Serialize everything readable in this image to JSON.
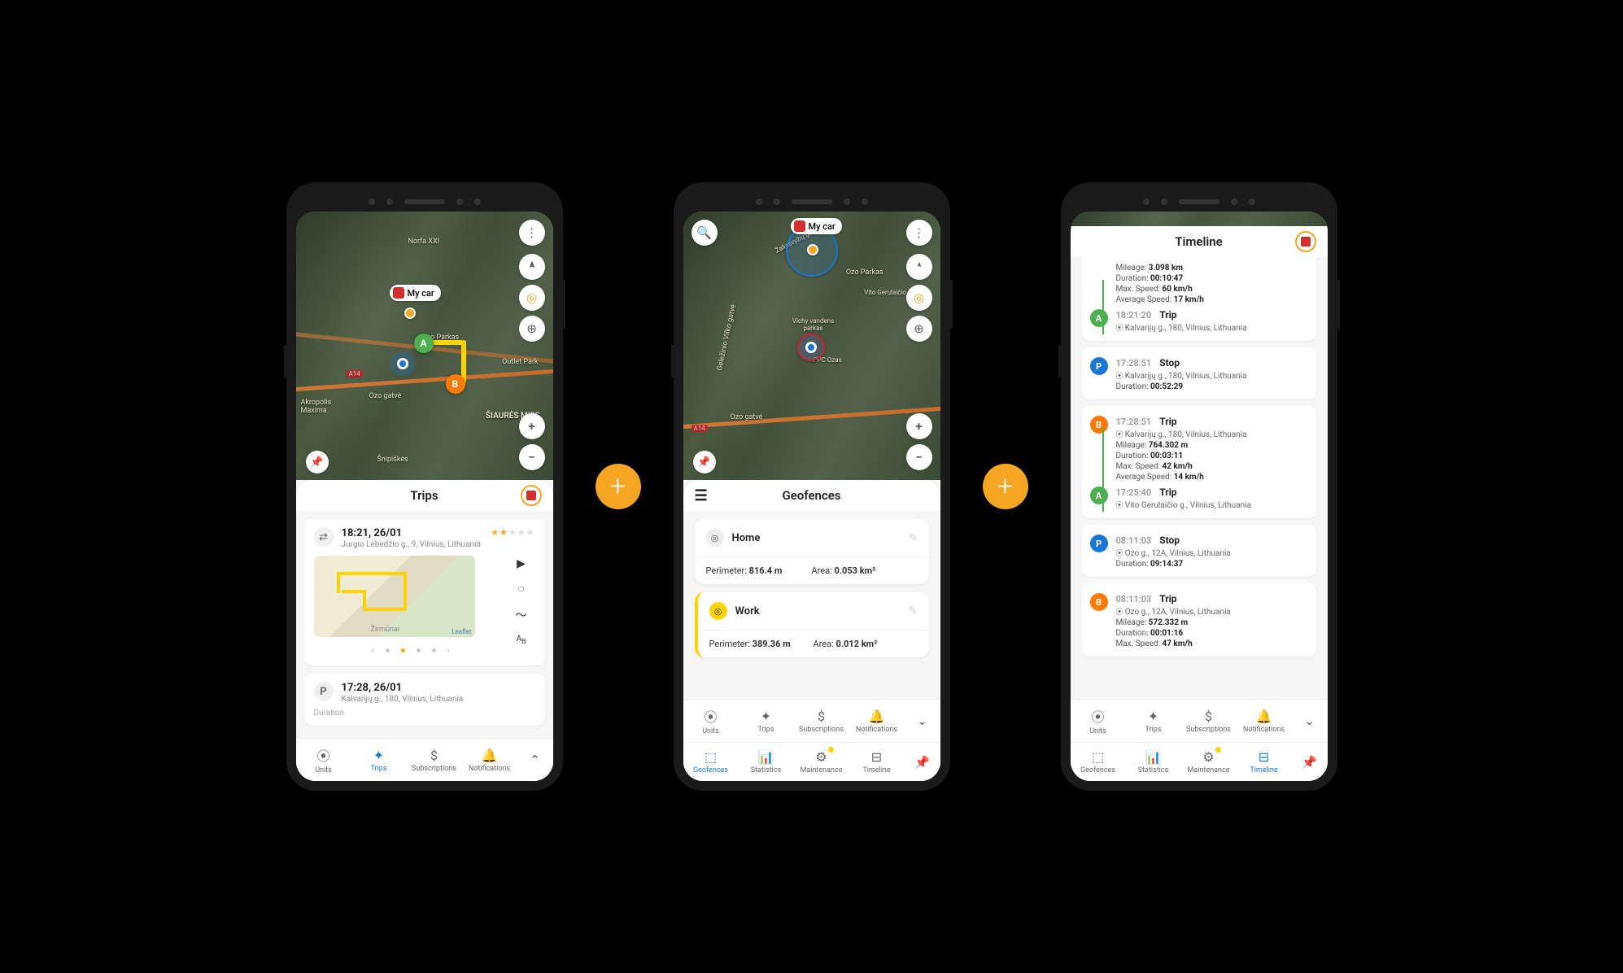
{
  "unit_label": "My car",
  "phone1": {
    "sheet_title": "Trips",
    "trip1": {
      "time": "18:21, 26/01",
      "address": "Jurgio Lebedžio g., 9, Vilnius, Lithuania"
    },
    "trip2": {
      "time": "17:28, 26/01",
      "address": "Kalvarijų g., 180, Vilnius, Lithuania",
      "duration_label": "Duration"
    },
    "nav": {
      "units": "Units",
      "trips": "Trips",
      "subscriptions": "Subscriptions",
      "notifications": "Notifications"
    },
    "map_texts": [
      "Norfa XXI",
      "Ozo Parkas",
      "Ozo gatvė",
      "Akropolis Maxima",
      "Outlet Park",
      "ŠIAURĖS MIES",
      "Šnipiškės",
      "A14"
    ]
  },
  "phone2": {
    "sheet_title": "Geofences",
    "home": {
      "name": "Home",
      "perimeter_label": "Perimeter:",
      "perimeter": "816.4 m",
      "area_label": "Area:",
      "area": "0.053 km²"
    },
    "work": {
      "name": "Work",
      "perimeter_label": "Perimeter:",
      "perimeter": "389.36 m",
      "area_label": "Area:",
      "area": "0.012 km²"
    },
    "nav1": {
      "units": "Units",
      "trips": "Trips",
      "subscriptions": "Subscriptions",
      "notifications": "Notifications"
    },
    "nav2": {
      "geofences": "Geofences",
      "statistics": "Statistics",
      "maintenance": "Maintenance",
      "timeline": "Timeline"
    },
    "map_texts": [
      "Geležinio Vilko gatvė",
      "Ozo gatvė",
      "Ozo Parkas",
      "Vito Gerulaičio gatvė",
      "A14",
      "Žaliašvyžių gatvė",
      "Vichy vandens parkas",
      "PPC Ozas"
    ]
  },
  "phone3": {
    "sheet_title": "Timeline",
    "labels": {
      "mileage": "Mileage:",
      "duration": "Duration:",
      "max": "Max. Speed:",
      "avg": "Average Speed:"
    },
    "partial_top": {
      "mileage": "3.098 km",
      "duration": "00:10:47",
      "max": "60 km/h",
      "avg": "17 km/h"
    },
    "events": [
      {
        "badge": "A",
        "time": "18:21:20",
        "type": "Trip",
        "loc": "Kalvarijų g., 180, Vilnius, Lithuania"
      },
      {
        "badge": "P",
        "time": "17:28:51",
        "type": "Stop",
        "loc": "Kalvarijų g., 180, Vilnius, Lithuania",
        "duration": "00:52:29"
      },
      {
        "badge": "B",
        "time": "17:28:51",
        "type": "Trip",
        "loc": "Kalvarijų g., 180, Vilnius, Lithuania",
        "mileage": "764.302 m",
        "duration": "00:03:11",
        "max": "42 km/h",
        "avg": "14 km/h",
        "end_badge": "A",
        "end_time": "17:25:40",
        "end_type": "Trip",
        "end_loc": "Vito Gerulaičio g., Vilnius, Lithuania"
      },
      {
        "badge": "P",
        "time": "08:11:03",
        "type": "Stop",
        "loc": "Ozo g., 12A, Vilnius, Lithuania",
        "duration": "09:14:37"
      },
      {
        "badge": "B",
        "time": "08:11:03",
        "type": "Trip",
        "loc": "Ozo g., 12A, Vilnius, Lithuania",
        "mileage": "572.332 m",
        "duration": "00:01:16",
        "max": "47 km/h"
      }
    ],
    "nav1": {
      "units": "Units",
      "trips": "Trips",
      "subscriptions": "Subscriptions",
      "notifications": "Notifications"
    },
    "nav2": {
      "geofences": "Geofences",
      "statistics": "Statistics",
      "maintenance": "Maintenance",
      "timeline": "Timeline"
    }
  }
}
